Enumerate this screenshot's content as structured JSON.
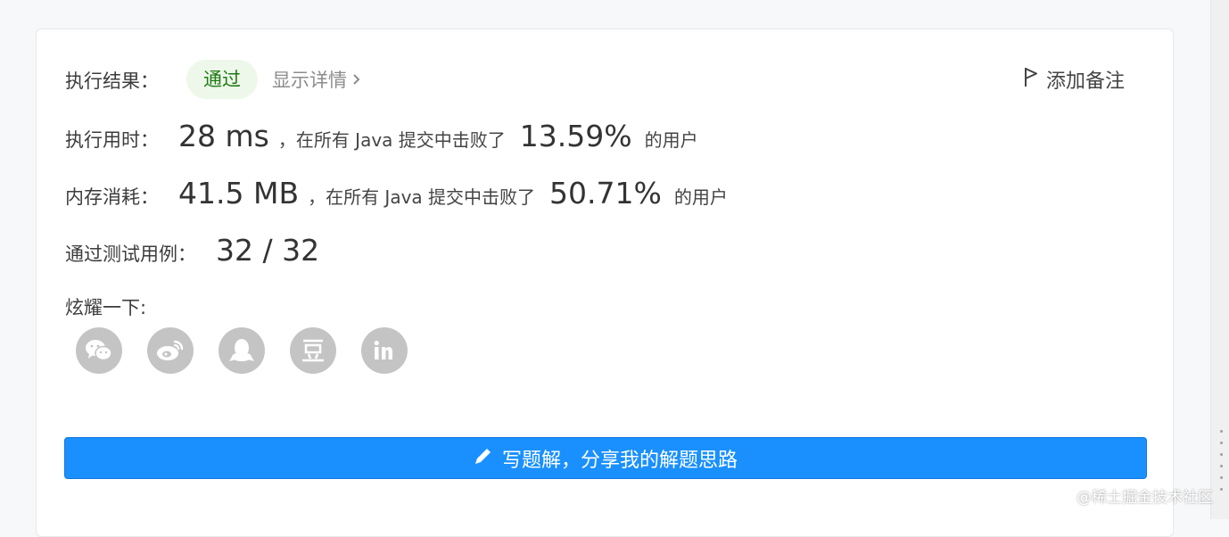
{
  "result": {
    "label": "执行结果：",
    "status": "通过",
    "details_link": "显示详情",
    "add_note": "添加备注"
  },
  "runtime": {
    "label": "执行用时：",
    "value": "28 ms",
    "prefix": "，在所有 Java 提交中击败了",
    "percent": "13.59%",
    "suffix": "的用户"
  },
  "memory": {
    "label": "内存消耗：",
    "value": "41.5 MB",
    "prefix": "，在所有 Java 提交中击败了",
    "percent": "50.71%",
    "suffix": "的用户"
  },
  "tests": {
    "label": "通过测试用例：",
    "value": "32 / 32"
  },
  "share": {
    "label": "炫耀一下:",
    "icons": [
      "wechat-icon",
      "weibo-icon",
      "qq-icon",
      "douban-icon",
      "linkedin-icon"
    ]
  },
  "write_button": "写题解，分享我的解题思路",
  "watermark": "@稀土掘金技术社区",
  "colors": {
    "accent": "#1a90ff",
    "success_bg": "#eef8ea",
    "success_text": "#1e7a14",
    "icon_bg": "#c4c4c4"
  }
}
